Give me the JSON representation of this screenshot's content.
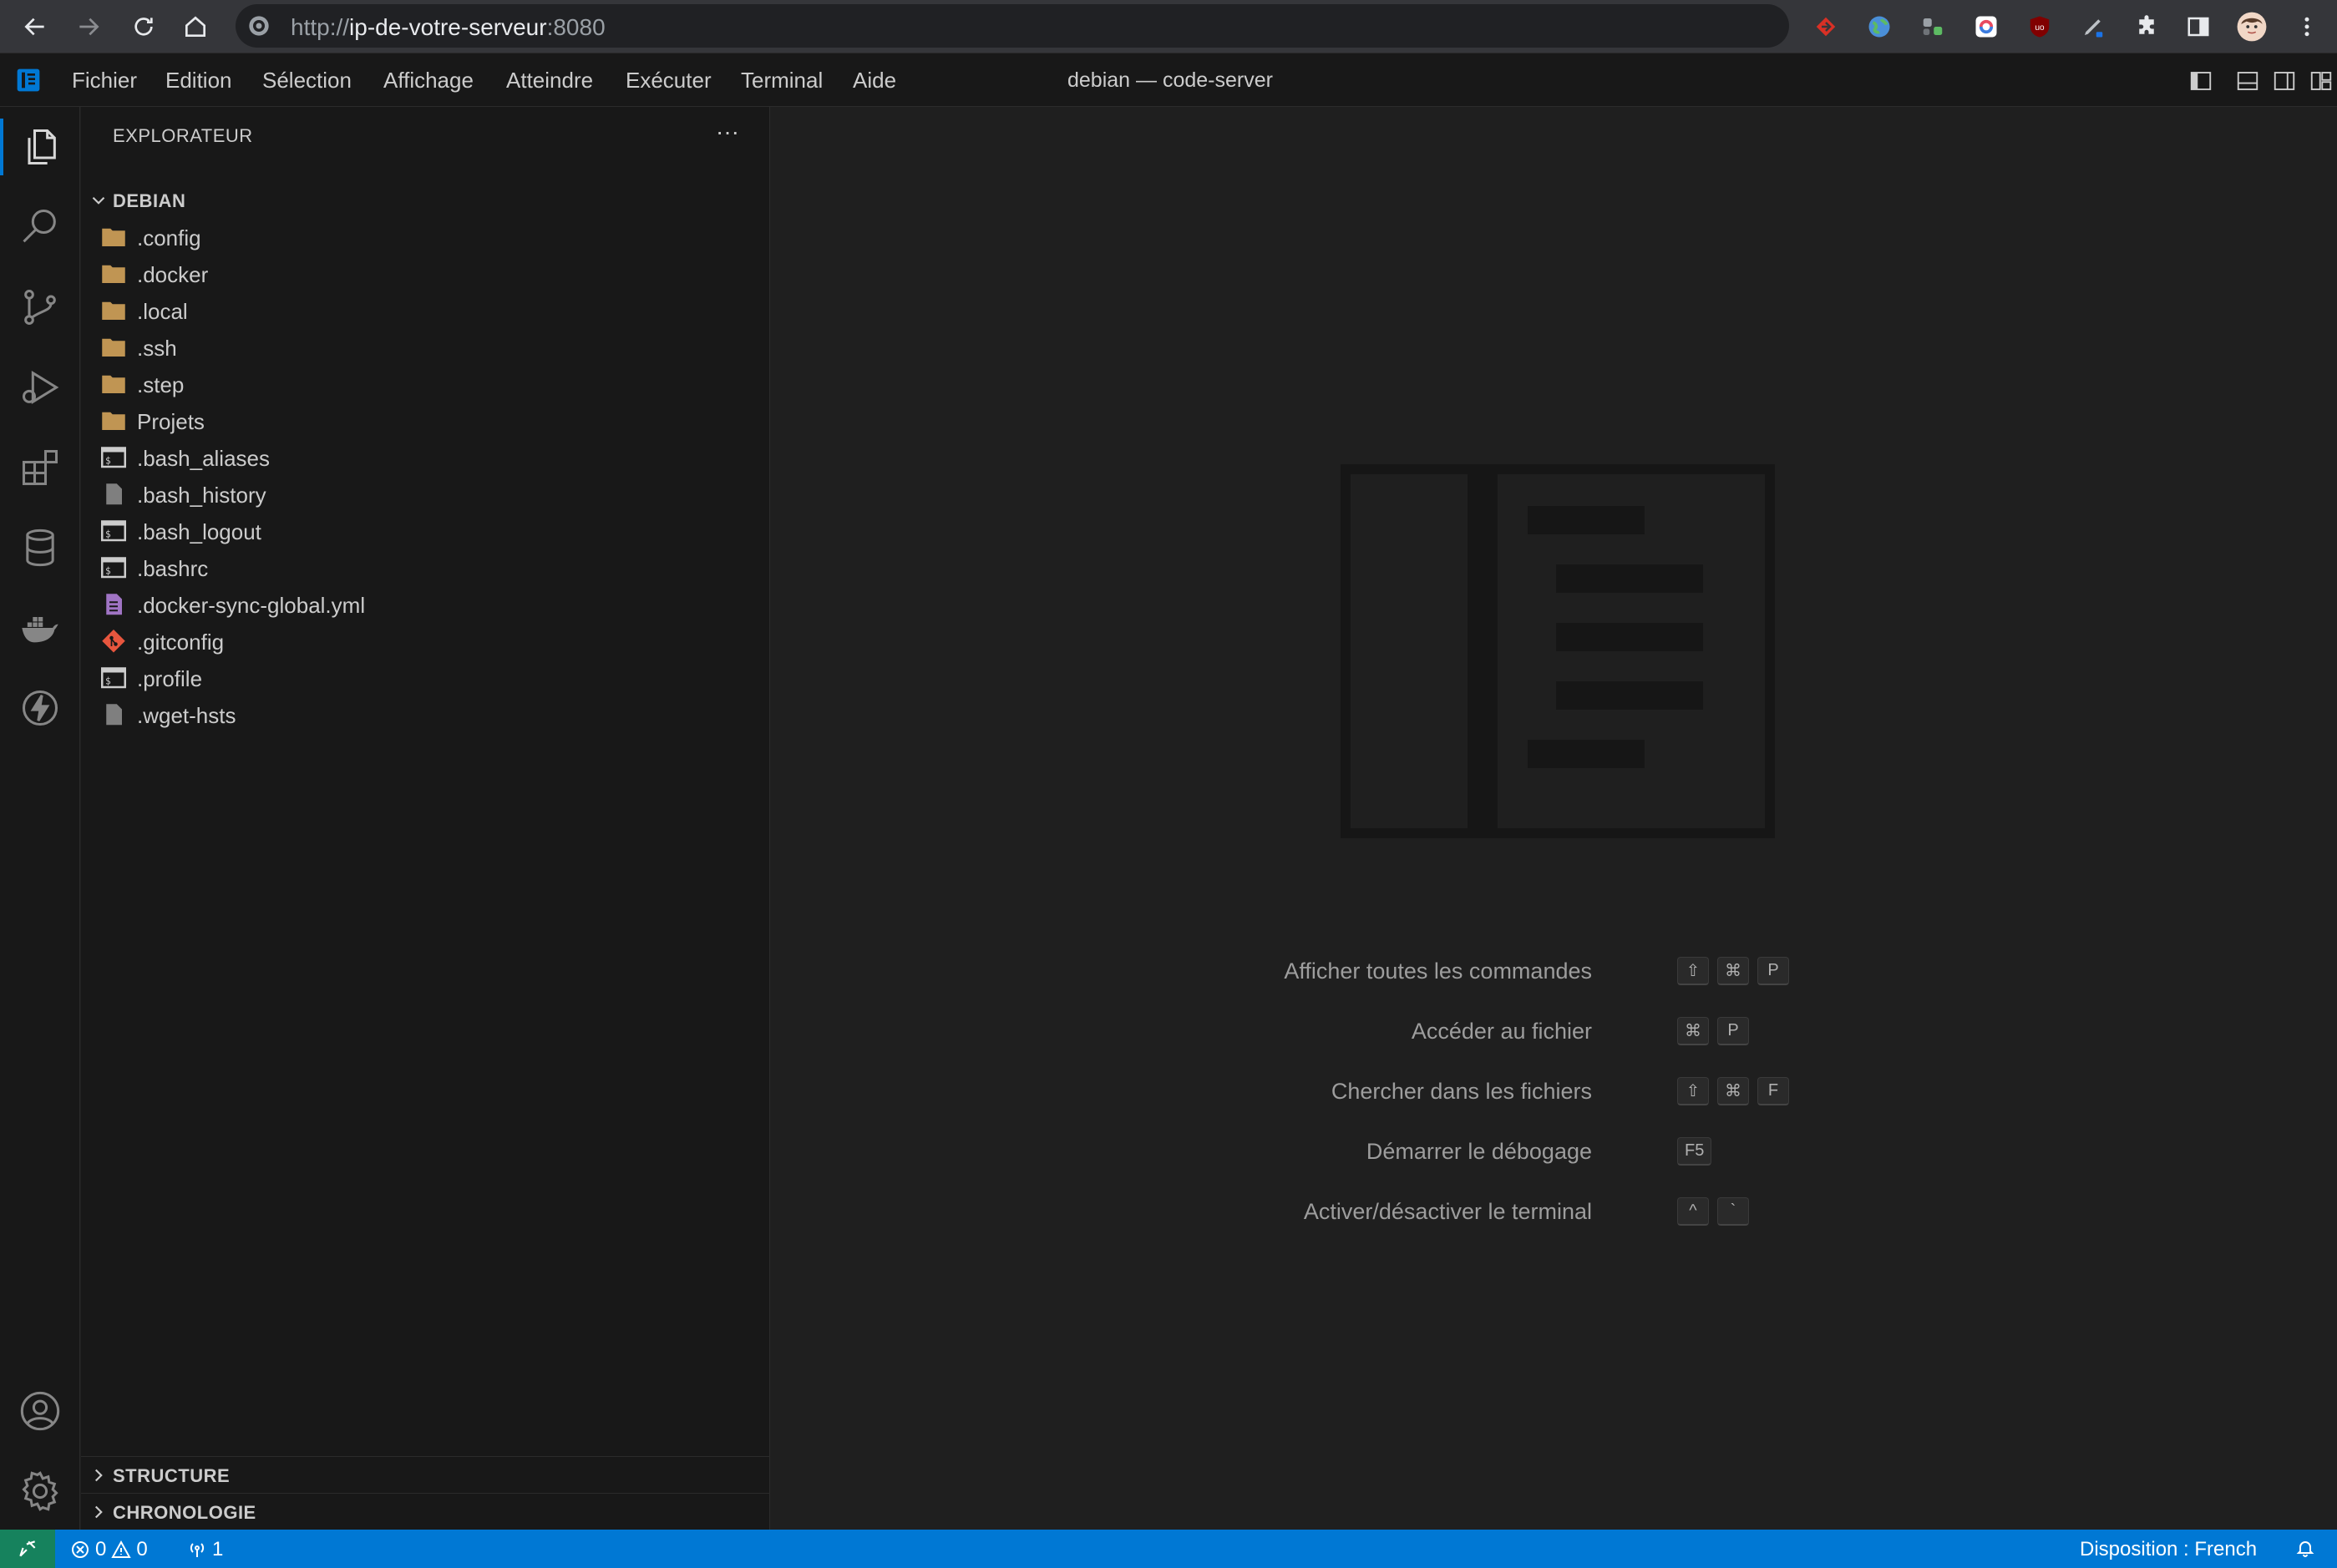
{
  "browser": {
    "url_prefix": "http://",
    "url_host": "ip-de-votre-serveur",
    "url_port": ":8080"
  },
  "titlebar": {
    "menu": [
      "Fichier",
      "Edition",
      "Sélection",
      "Affichage",
      "Atteindre",
      "Exécuter",
      "Terminal",
      "Aide"
    ],
    "window_title": "debian — code-server"
  },
  "activity_bar": {
    "items": [
      "explorer-icon",
      "search-icon",
      "source-control-icon",
      "run-debug-icon",
      "extensions-icon",
      "database-icon",
      "docker-icon",
      "lightning-icon"
    ],
    "bottom": [
      "account-icon",
      "settings-gear-icon"
    ]
  },
  "sidebar": {
    "title": "EXPLORATEUR",
    "more": "···",
    "root_folder": "DEBIAN",
    "files": [
      {
        "name": ".config",
        "kind": "folder"
      },
      {
        "name": ".docker",
        "kind": "folder"
      },
      {
        "name": ".local",
        "kind": "folder"
      },
      {
        "name": ".ssh",
        "kind": "folder"
      },
      {
        "name": ".step",
        "kind": "folder"
      },
      {
        "name": "Projets",
        "kind": "folder"
      },
      {
        "name": ".bash_aliases",
        "kind": "shell"
      },
      {
        "name": ".bash_history",
        "kind": "file"
      },
      {
        "name": ".bash_logout",
        "kind": "shell"
      },
      {
        "name": ".bashrc",
        "kind": "shell"
      },
      {
        "name": ".docker-sync-global.yml",
        "kind": "yaml"
      },
      {
        "name": ".gitconfig",
        "kind": "git"
      },
      {
        "name": ".profile",
        "kind": "shell"
      },
      {
        "name": ".wget-hsts",
        "kind": "file"
      }
    ],
    "sections": [
      "STRUCTURE",
      "CHRONOLOGIE"
    ]
  },
  "editor": {
    "shortcuts": [
      {
        "label": "Afficher toutes les commandes",
        "keys": [
          "⇧",
          "⌘",
          "P"
        ]
      },
      {
        "label": "Accéder au fichier",
        "keys": [
          "⌘",
          "P"
        ]
      },
      {
        "label": "Chercher dans les fichiers",
        "keys": [
          "⇧",
          "⌘",
          "F"
        ]
      },
      {
        "label": "Démarrer le débogage",
        "keys": [
          "F5"
        ]
      },
      {
        "label": "Activer/désactiver le terminal",
        "keys": [
          "^",
          "`"
        ]
      }
    ]
  },
  "statusbar": {
    "errors": "0",
    "warnings": "0",
    "ports": "1",
    "layout": "Disposition : French"
  },
  "colors": {
    "accent": "#0078d4",
    "remote": "#16825d",
    "folder": "#c09553",
    "git": "#e8563e",
    "yaml": "#a074c4"
  }
}
